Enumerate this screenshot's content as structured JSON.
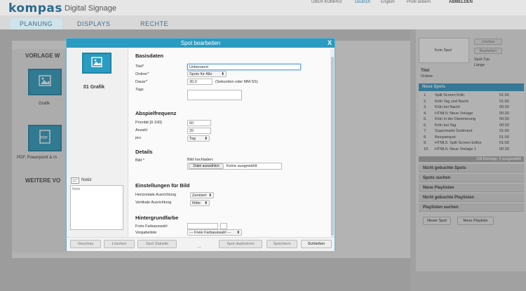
{
  "header": {
    "logo": "kompas",
    "app_name": "Digital Signage",
    "links": [
      "ÜBER KOMPAS",
      "Deutsch",
      "English",
      "Profil ändern",
      "ABMELDEN"
    ]
  },
  "tabs": [
    "PLANUNG",
    "DISPLAYS",
    "RECHTE"
  ],
  "left_panel": {
    "vorlage_title": "VORLAGE W",
    "grafik_label": "Grafik",
    "pdf_label": "PDF, Powerpoint & m",
    "pdf_icon_text": "PDF",
    "weitere_title": "WEITERE VO"
  },
  "dialog": {
    "title": "Spot bearbeiten",
    "close": "X",
    "thumb_label": "01 Grafik",
    "notiz_title": "Notiz",
    "notiz_placeholder": "Notiz",
    "basisdaten": {
      "title": "Basisdaten",
      "titel_label": "Titel*",
      "titel_value": "Unbenannt",
      "ordner_label": "Ordner*",
      "ordner_value": "Spots für Alle",
      "dauer_label": "Dauer*",
      "dauer_value": "30,0",
      "dauer_hint": "(Sekunden oder MM:SS)",
      "tags_label": "Tags"
    },
    "abspiel": {
      "title": "Abspielfrequenz",
      "prio_label": "Priorität [0-100]",
      "prio_value": "60",
      "anzahl_label": "Anzahl",
      "anzahl_value": "20",
      "pro_label": "pro",
      "pro_value": "Tag"
    },
    "details": {
      "title": "Details",
      "bild_label": "Bild *",
      "upload_label": "Bild hochladen:",
      "file_button": "Datei auswählen",
      "file_status": "Keine ausgewählt"
    },
    "bild": {
      "title": "Einstellungen für Bild",
      "h_label": "Horizontale Ausrichtung",
      "h_value": "Zentriert",
      "v_label": "Vertikale Ausrichtung",
      "v_value": "Mitte"
    },
    "hintergrund": {
      "title": "Hintergrundfarbe",
      "frei_label": "Freie Farbauswahl",
      "vorgabe_label": "Vorgabeliste",
      "vorgabe_value": "--- Freie Farbauswahl ---"
    },
    "buttons": [
      "Vorschau",
      "Löschen",
      "Spot Statistik",
      "Spot duplizieren",
      "Speichern",
      "Schließen"
    ],
    "more": "..."
  },
  "right_panel": {
    "preview_label": "Kein Spot",
    "side_btns": [
      "Löschen",
      "Bearbeiten"
    ],
    "spot_typ_label": "Spot-Typ",
    "laenge_label": "Länge",
    "titel_label": "Titel",
    "ordner_label": "Ordner",
    "neue_spots": "Neue Spots",
    "spots": [
      {
        "n": "1.",
        "name": "Split Screen Köln",
        "t": "01:00"
      },
      {
        "n": "2.",
        "name": "Köln Tag und Nacht",
        "t": "01:00"
      },
      {
        "n": "3.",
        "name": "Köln bei Nacht",
        "t": "00:30"
      },
      {
        "n": "4.",
        "name": "HTML5: Neue Vorlage",
        "t": "00:30"
      },
      {
        "n": "5.",
        "name": "Köln in der Dämmerung",
        "t": "00:30"
      },
      {
        "n": "6.",
        "name": "Köln bei Tag",
        "t": "00:30"
      },
      {
        "n": "7.",
        "name": "Supermarkt Sortiment",
        "t": "01:00"
      },
      {
        "n": "8.",
        "name": "Beispielspot",
        "t": "01:00"
      },
      {
        "n": "9.",
        "name": "HTML5: Split Screen Editor",
        "t": "01:00"
      },
      {
        "n": "10.",
        "name": "HTML5: Neue Vorlage 1",
        "t": "00:30"
      }
    ],
    "list_footer": "138 Einträge, 0 ausgewählt",
    "sections": [
      "Nicht gebuchte Spots",
      "Spots suchen",
      "Neue Playlisten",
      "Nicht gebuchte Playlisten",
      "Playlisten suchen"
    ],
    "bottom_buttons": [
      "Neuer Spot",
      "Neue Playliste"
    ]
  }
}
